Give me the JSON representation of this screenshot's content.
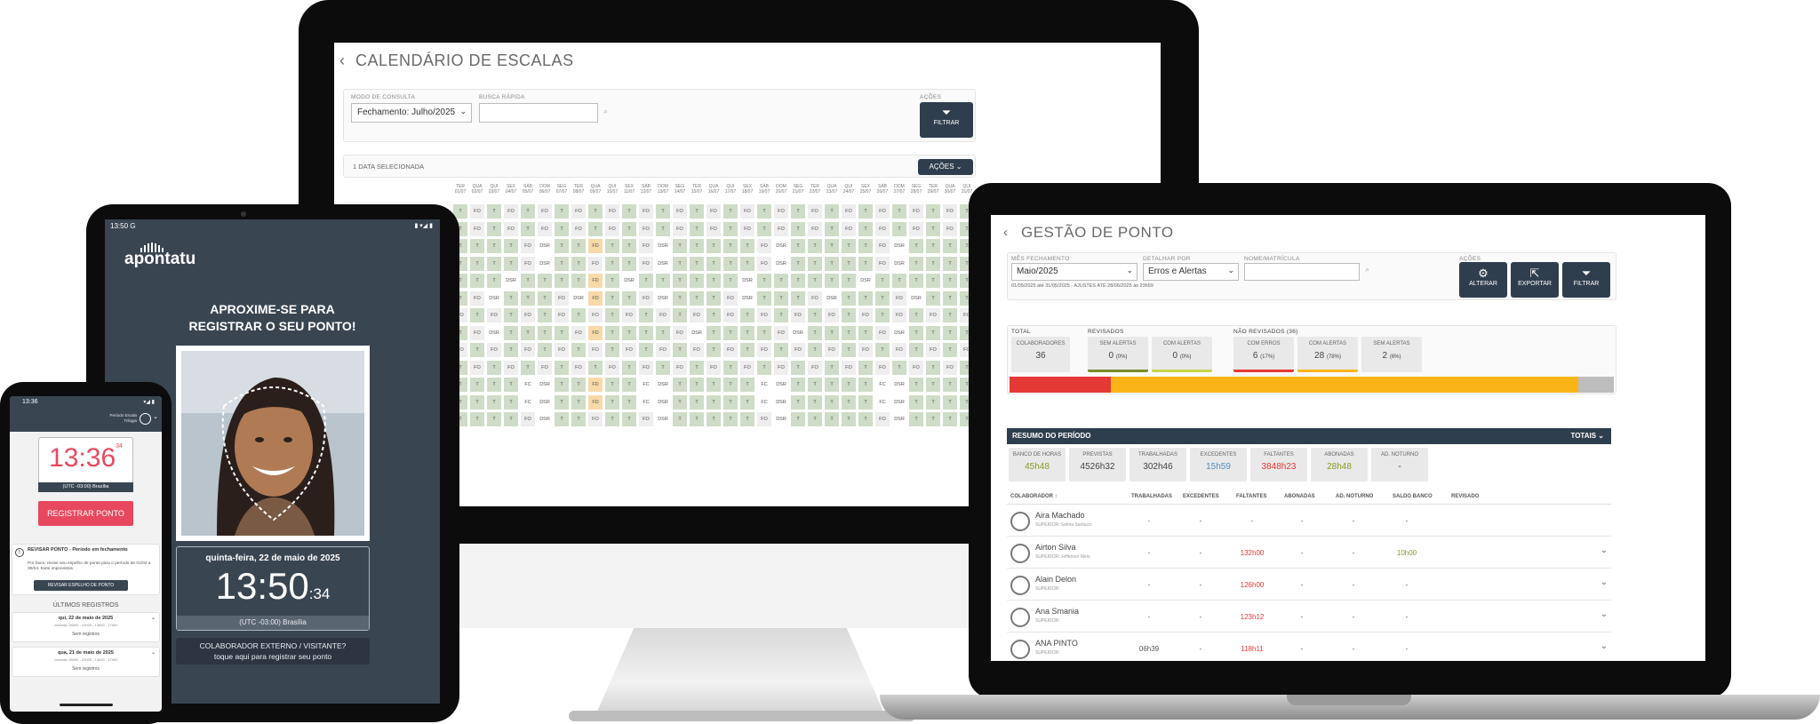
{
  "monitor": {
    "title": "CALENDÁRIO DE ESCALAS",
    "back_icon": "chevron-left-icon",
    "mode_label": "MODO DE CONSULTA",
    "mode_value": "Fechamento: Julho/2025",
    "search_label": "BUSCA RÁPIDA",
    "search_value": "",
    "actions_label": "AÇÕES",
    "filter_label": "FILTRAR",
    "selected_text": "1 DATA SELECIONADA",
    "actions_button": "AÇÕES",
    "day_headers": [
      "TER",
      "QUA",
      "QUI",
      "SEX",
      "SÁB",
      "DOM",
      "SEG",
      "TER",
      "QUA",
      "QUI",
      "SEX",
      "SÁB",
      "DOM",
      "SEG",
      "TER",
      "QUA",
      "QUI",
      "SEX",
      "SÁB",
      "DOM",
      "SEG",
      "TER",
      "QUA",
      "QUI",
      "SEX",
      "SÁB",
      "DOM",
      "SEG",
      "TER",
      "QUA",
      "QUI"
    ],
    "date_headers": [
      "01/07",
      "02/07",
      "03/07",
      "04/07",
      "05/07",
      "06/07",
      "07/07",
      "08/07",
      "09/07",
      "10/07",
      "11/07",
      "12/07",
      "13/07",
      "14/07",
      "15/07",
      "16/07",
      "17/07",
      "18/07",
      "19/07",
      "20/07",
      "21/07",
      "22/07",
      "23/07",
      "24/07",
      "25/07",
      "26/07",
      "27/07",
      "28/07",
      "29/07",
      "30/07",
      "31/07"
    ],
    "grid_rows": [
      [
        "T",
        "FO",
        "T",
        "FO",
        "T",
        "FO",
        "T",
        "FO",
        "T",
        "FO",
        "T",
        "FO",
        "T",
        "FO",
        "T",
        "FO",
        "T",
        "FO",
        "T",
        "FO",
        "T",
        "FO",
        "T",
        "FO",
        "T",
        "FO",
        "T",
        "FO",
        "T",
        "FO",
        "T"
      ],
      [
        "T",
        "FO",
        "T",
        "FO",
        "T",
        "FO",
        "T",
        "FO",
        "T",
        "FO",
        "T",
        "FO",
        "T",
        "FO",
        "T",
        "FO",
        "T",
        "FO",
        "T",
        "FO",
        "T",
        "FO",
        "T",
        "FO",
        "T",
        "FO",
        "T",
        "FO",
        "T",
        "FO",
        "T"
      ],
      [
        "T",
        "T",
        "T",
        "T",
        "FO",
        "DSR",
        "T",
        "T",
        "FD",
        "T",
        "T",
        "FO",
        "DSR",
        "T",
        "T",
        "T",
        "T",
        "T",
        "FO",
        "DSR",
        "T",
        "T",
        "T",
        "T",
        "T",
        "FO",
        "DSR",
        "T",
        "T",
        "T",
        "T"
      ],
      [
        "T",
        "T",
        "T",
        "T",
        "FO",
        "DSR",
        "T",
        "T",
        "FO",
        "T",
        "T",
        "FO",
        "DSR",
        "T",
        "T",
        "T",
        "T",
        "T",
        "FO",
        "DSR",
        "T",
        "T",
        "T",
        "T",
        "T",
        "FO",
        "DSR",
        "T",
        "T",
        "T",
        "T"
      ],
      [
        "T",
        "T",
        "T",
        "DSR",
        "T",
        "T",
        "T",
        "T",
        "FD",
        "T",
        "DSR",
        "T",
        "T",
        "T",
        "T",
        "T",
        "T",
        "DSR",
        "T",
        "T",
        "T",
        "T",
        "T",
        "T",
        "DSR",
        "T",
        "T",
        "T",
        "T",
        "T",
        "T"
      ],
      [
        "T",
        "FO",
        "DSR",
        "T",
        "T",
        "T",
        "FO",
        "DSR",
        "FD",
        "T",
        "T",
        "FO",
        "DSR",
        "T",
        "T",
        "T",
        "FO",
        "DSR",
        "T",
        "T",
        "T",
        "FO",
        "DSR",
        "T",
        "T",
        "T",
        "FO",
        "DSR",
        "T",
        "T",
        "T"
      ],
      [
        "FO",
        "T",
        "FO",
        "T",
        "FO",
        "T",
        "FO",
        "T",
        "FO",
        "T",
        "FO",
        "T",
        "FO",
        "T",
        "FO",
        "T",
        "FO",
        "T",
        "FO",
        "T",
        "FO",
        "T",
        "FO",
        "T",
        "FO",
        "T",
        "FO",
        "T",
        "FO",
        "T",
        "FO"
      ],
      [
        "T",
        "FO",
        "DSR",
        "T",
        "T",
        "T",
        "T",
        "FO",
        "FD",
        "T",
        "T",
        "T",
        "T",
        "FO",
        "DSR",
        "T",
        "T",
        "T",
        "T",
        "FO",
        "DSR",
        "T",
        "T",
        "T",
        "T",
        "FO",
        "DSR",
        "T",
        "T",
        "T",
        "T"
      ],
      [
        "FO",
        "T",
        "FO",
        "T",
        "FO",
        "T",
        "FO",
        "T",
        "FO",
        "T",
        "FO",
        "T",
        "FO",
        "T",
        "FO",
        "T",
        "FO",
        "T",
        "FO",
        "T",
        "FO",
        "T",
        "FO",
        "T",
        "FO",
        "T",
        "FO",
        "T",
        "FO",
        "T",
        "FO"
      ],
      [
        "T",
        "FO",
        "T",
        "FO",
        "T",
        "FO",
        "T",
        "FO",
        "T",
        "FO",
        "T",
        "FO",
        "T",
        "FO",
        "T",
        "FO",
        "T",
        "FO",
        "T",
        "FO",
        "T",
        "FO",
        "T",
        "FO",
        "T",
        "FO",
        "T",
        "FO",
        "T",
        "FO",
        "T"
      ],
      [
        "T",
        "T",
        "T",
        "T",
        "FC",
        "DSR",
        "T",
        "T",
        "FD",
        "T",
        "T",
        "FC",
        "DSR",
        "T",
        "T",
        "T",
        "T",
        "T",
        "FC",
        "DSR",
        "T",
        "T",
        "T",
        "T",
        "T",
        "FC",
        "DSR",
        "T",
        "T",
        "T",
        "T"
      ],
      [
        "T",
        "T",
        "T",
        "T",
        "FC",
        "DSR",
        "T",
        "T",
        "FD",
        "T",
        "T",
        "FC",
        "DSR",
        "T",
        "T",
        "T",
        "T",
        "T",
        "FC",
        "DSR",
        "T",
        "T",
        "T",
        "T",
        "T",
        "FC",
        "DSR",
        "T",
        "T",
        "T",
        "T"
      ],
      [
        "T",
        "T",
        "T",
        "T",
        "FO",
        "DSR",
        "T",
        "T",
        "FO",
        "T",
        "T",
        "FO",
        "DSR",
        "T",
        "T",
        "T",
        "T",
        "T",
        "FO",
        "DSR",
        "T",
        "T",
        "T",
        "T",
        "T",
        "FO",
        "DSR",
        "T",
        "T",
        "T",
        "T"
      ]
    ]
  },
  "laptop": {
    "title": "GESTÃO DE PONTO",
    "back_icon": "chevron-left-icon",
    "mes_label": "MÊS FECHAMENTO",
    "mes_value": "Maio/2025",
    "detalhar_label": "DETALHAR POR",
    "detalhar_value": "Erros e Alertas",
    "nome_label": "NOME/MATRÍCULA",
    "nome_value": "",
    "period_note": "01/05/2025 até 31/05/2025 - AJUSTES ATÉ 28/06/2025 às 23h59",
    "actions_label": "AÇÕES",
    "buttons": [
      {
        "label": "ALTERAR",
        "icon": "gear-icon"
      },
      {
        "label": "EXPORTAR",
        "icon": "export-icon"
      },
      {
        "label": "FILTRAR",
        "icon": "filter-icon"
      }
    ],
    "total_label": "TOTAL",
    "revisados_label": "REVISADOS",
    "nao_revisados_label": "NÃO REVISADOS (36)",
    "stats": {
      "colaboradores": {
        "t": "COLABORADORES",
        "v": "36"
      },
      "rev_sem": {
        "t": "SEM ALERTAS",
        "v": "0",
        "p": "(0%)"
      },
      "rev_com": {
        "t": "COM ALERTAS",
        "v": "0",
        "p": "(0%)"
      },
      "nr_erros": {
        "t": "COM ERROS",
        "v": "6",
        "p": "(17%)"
      },
      "nr_alertas": {
        "t": "COM ALERTAS",
        "v": "28",
        "p": "(78%)"
      },
      "nr_sem": {
        "t": "SEM ALERTAS",
        "v": "2",
        "p": "(6%)"
      }
    },
    "colors": {
      "red": "#e53935",
      "amber": "#fbb418",
      "gray": "#bdbdbd",
      "olive": "#8a9a2a",
      "green": "#7cb342"
    },
    "distribution_percent": {
      "com_erros": 17,
      "com_alertas": 78,
      "sem_alertas": 6
    },
    "resumo_label": "RESUMO DO PERÍODO",
    "totais_label": "TOTAIS",
    "resumo": [
      {
        "t": "BANCO DE HORAS",
        "v": "45h48"
      },
      {
        "t": "PREVISTAS",
        "v": "4526h32"
      },
      {
        "t": "TRABALHADAS",
        "v": "302h46"
      },
      {
        "t": "EXCEDENTES",
        "v": "15h59"
      },
      {
        "t": "FALTANTES",
        "v": "3848h23"
      },
      {
        "t": "ABONADAS",
        "v": "28h48"
      },
      {
        "t": "AD. NOTURNO",
        "v": "-"
      }
    ],
    "columns": [
      "COLABORADOR ↑",
      "TRABALHADAS",
      "EXCEDENTES",
      "FALTANTES",
      "ABONADAS",
      "AD. NOTURNO",
      "SALDO BANCO",
      "REVISADO"
    ],
    "rows": [
      {
        "name": "Aira Machado",
        "sup": "SUPERIOR: Selma Santucci",
        "trab": "-",
        "exc": "-",
        "falt": "-",
        "abon": "-",
        "adn": "-",
        "saldo": "-"
      },
      {
        "name": "Airton Silva",
        "sup": "SUPERIOR: Jefferson Melo",
        "trab": "-",
        "exc": "-",
        "falt": "132h00",
        "abon": "-",
        "adn": "-",
        "saldo": "10h00"
      },
      {
        "name": "Alain Delon",
        "sup": "SUPERIOR:",
        "trab": "-",
        "exc": "-",
        "falt": "126h00",
        "abon": "-",
        "adn": "-",
        "saldo": "-"
      },
      {
        "name": "Ana Smania",
        "sup": "SUPERIOR:",
        "trab": "-",
        "exc": "-",
        "falt": "123h12",
        "abon": "-",
        "adn": "-",
        "saldo": "-"
      },
      {
        "name": "ANA PINTO",
        "sup": "SUPERIOR:",
        "trab": "06h39",
        "exc": "-",
        "falt": "118h11",
        "abon": "-",
        "adn": "-",
        "saldo": "-"
      }
    ]
  },
  "tablet": {
    "status_time": "13:50",
    "status_g": "G",
    "status_icons": "▮ ▾◢ ▮",
    "logo": "apontatu",
    "heading_line1": "APROXIME-SE PARA",
    "heading_line2": "REGISTRAR O SEU PONTO!",
    "date": "quinta-feira, 22 de maio de 2025",
    "time": "13:50",
    "seconds": ":34",
    "timezone": "(UTC -03:00) Brasília",
    "external_line1": "COLABORADOR EXTERNO / VISITANTE?",
    "external_line2": "toque aqui para registrar seu ponto"
  },
  "phone": {
    "status_time": "13:36",
    "status_icons": "▾◢ ▮",
    "user_line1": "Período Escala",
    "user_line2": "Trilogia",
    "clock": "13:36",
    "clock_seconds": "34",
    "timezone": "(UTC -03:00) Brasília",
    "register_button": "REGISTRAR PONTO",
    "alert_title": "REVISAR PONTO - Período em fechamento",
    "alert_text": "Por favor, revise seu espelho de ponto para o período de 01/04 a 30/04. Evite imprevistos.",
    "alert_button": "REVISAR ESPELHO DE PONTO",
    "last_label": "ÚLTIMOS REGISTROS",
    "records": [
      {
        "date": "qui, 22 de maio de 2025",
        "detail": "Jornada: 08h00 - 12h00 - 13h00 - 17h00",
        "status": "Sem registros"
      },
      {
        "date": "qua, 21 de maio de 2025",
        "detail": "Jornada: 08h00 - 12h00 - 13h00 - 17h00",
        "status": "Sem registros"
      }
    ]
  }
}
